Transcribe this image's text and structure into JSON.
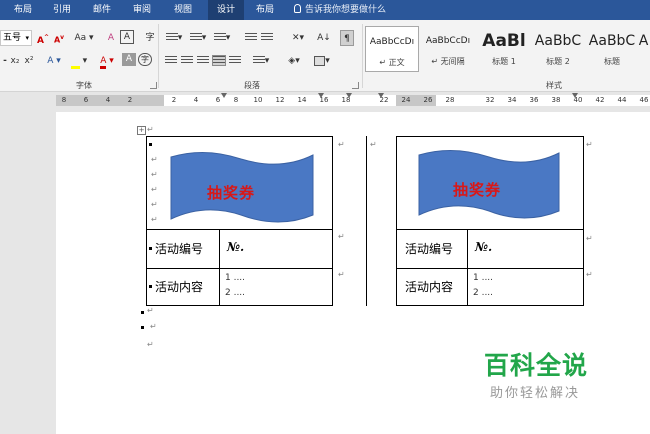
{
  "tabs": [
    {
      "label": "布局",
      "active": false
    },
    {
      "label": "引用",
      "active": false
    },
    {
      "label": "邮件",
      "active": false
    },
    {
      "label": "审阅",
      "active": false
    },
    {
      "label": "视图",
      "active": false
    },
    {
      "label": "设计",
      "active": true
    },
    {
      "label": "布局",
      "active": false
    }
  ],
  "tell_me": "告诉我你想要做什么",
  "ribbon": {
    "font_size_value": "五号",
    "grow_font": "A",
    "shrink_font": "A",
    "change_case": "Aa",
    "clear_format": "A",
    "char_border": "A",
    "subscript": "x₂",
    "superscript": "x²",
    "text_effect": "A",
    "font_color": "A",
    "char_shading": "A",
    "enclose_char": "字",
    "font_group_label": "字体",
    "paragraph_group_label": "段落",
    "styles_group_label": "样式",
    "sort_glyph": "A↓"
  },
  "styles": [
    {
      "preview": "AaBbCcDı",
      "name": "↵ 正文",
      "selected": true
    },
    {
      "preview": "AaBbCcDı",
      "name": "↵ 无间隔",
      "selected": false
    },
    {
      "preview": "AaBl",
      "name": "标题 1",
      "selected": false
    },
    {
      "preview": "AaBbC",
      "name": "标题 2",
      "selected": false
    },
    {
      "preview": "AaBbC",
      "name": "标题",
      "selected": false
    },
    {
      "preview": "A",
      "name": "",
      "selected": false
    }
  ],
  "ruler_ticks": [
    "8",
    "6",
    "4",
    "2",
    "2",
    "4",
    "6",
    "8",
    "10",
    "12",
    "14",
    "16",
    "18",
    "22",
    "24",
    "26",
    "28",
    "32",
    "34",
    "36",
    "38",
    "40",
    "42",
    "44",
    "46"
  ],
  "document": {
    "ticket_left": {
      "banner": "抽奖券",
      "id_label": "活动编号",
      "no_mark": "№.",
      "content_label": "活动内容",
      "line1": "1 ....",
      "line2": "2 ...."
    },
    "ticket_right": {
      "banner": "抽奖券",
      "id_label": "活动编号",
      "no_mark": "№.",
      "content_label": "活动内容",
      "line1": "1 ....",
      "line2": "2 ...."
    },
    "para_mark": "↵",
    "handle_glyph": "+"
  },
  "watermark": {
    "title": "百科全说",
    "subtitle": "助你轻松解决"
  },
  "colors": {
    "tabbar": "#2b579a",
    "banner_fill": "#4a78c4",
    "banner_text": "#d81818",
    "watermark": "#22a64a"
  }
}
